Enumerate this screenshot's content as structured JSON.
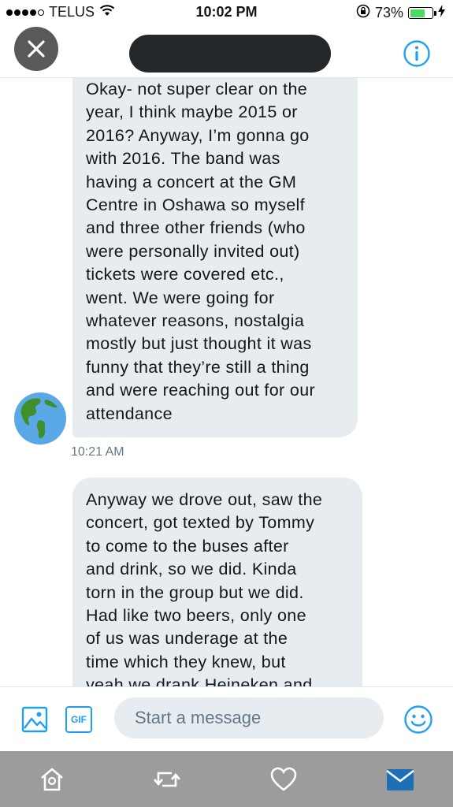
{
  "status_bar": {
    "carrier": "TELUS",
    "time": "10:02 PM",
    "battery_percent": "73%",
    "battery_level": 0.73,
    "icons": [
      "signal-dots-icon",
      "wifi-icon",
      "orientation-lock-icon",
      "battery-icon",
      "charging-bolt-icon"
    ]
  },
  "header": {
    "close_icon": "close-icon",
    "info_icon": "info-icon"
  },
  "messages": [
    {
      "text": "Okay- not super clear on the\nyear, I think maybe 2015 or\n2016? Anyway, I’m gonna go\nwith 2016. The band was\nhaving a concert at the GM\nCentre in Oshawa so myself\nand three other friends (who\nwere personally invited out)\ntickets were covered etc.,\nwent. We were going for\nwhatever reasons, nostalgia\nmostly but just thought it was\nfunny that they’re still a thing\nand were reaching out for our\nattendance",
      "timestamp": "10:21 AM",
      "avatar_icon": "globe-americas-icon"
    },
    {
      "text": "Anyway we drove out, saw the\nconcert, got texted by Tommy\nto come to the buses after\nand drink, so we did. Kinda\ntorn in the group but we did.\nHad like two beers, only one\nof us was underage at the\ntime which they knew, but\nyeah we drank Heineken and"
    }
  ],
  "composer": {
    "placeholder": "Start a message",
    "gif_label": "GIF",
    "icons": [
      "image-icon",
      "gif-icon",
      "emoji-icon"
    ]
  },
  "tab_bar": {
    "tabs": [
      "home-icon",
      "retweet-icon",
      "heart-icon",
      "messages-icon"
    ],
    "active_tab": "messages-icon"
  },
  "colors": {
    "accent": "#1da1f2",
    "bubble": "#e6ecf0",
    "tab_bar_bg": "#9c9c9c",
    "battery_fill": "#4cd964",
    "muted_text": "#657786"
  }
}
